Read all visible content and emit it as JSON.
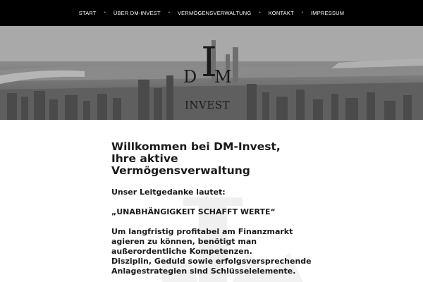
{
  "nav": {
    "items": [
      {
        "label": "START"
      },
      {
        "label": "ÜBER DM-INVEST"
      },
      {
        "label": "VERMÖGENSVERWALTUNG"
      },
      {
        "label": "KONTAKT"
      },
      {
        "label": "IMPRESSUM"
      }
    ],
    "separator": "•"
  },
  "hero": {
    "logo": {
      "letter_d": "D",
      "letter_i": "I",
      "letter_m": "M",
      "word": "INVEST"
    }
  },
  "main": {
    "title_lines": [
      "Willkommen bei DM-Invest,",
      "Ihre aktive",
      "Vermögensverwaltung"
    ],
    "motto_intro": "Unser Leitgedanke lautet:",
    "motto": "„UNABHÄNGIGKEIT SCHAFFT WERTE“",
    "body_lines": [
      "Um langfristig profitabel am Finanzmarkt",
      "agieren zu können, benötigt man",
      "außerordentliche Kompetenzen.",
      "Disziplin, Geduld sowie erfolgsversprechende",
      "Anlagestrategien sind Schlüsselelemente."
    ]
  },
  "colors": {
    "nav_bg": "#000000",
    "text": "#1a1a1a",
    "page_bg": "#ffffff"
  }
}
